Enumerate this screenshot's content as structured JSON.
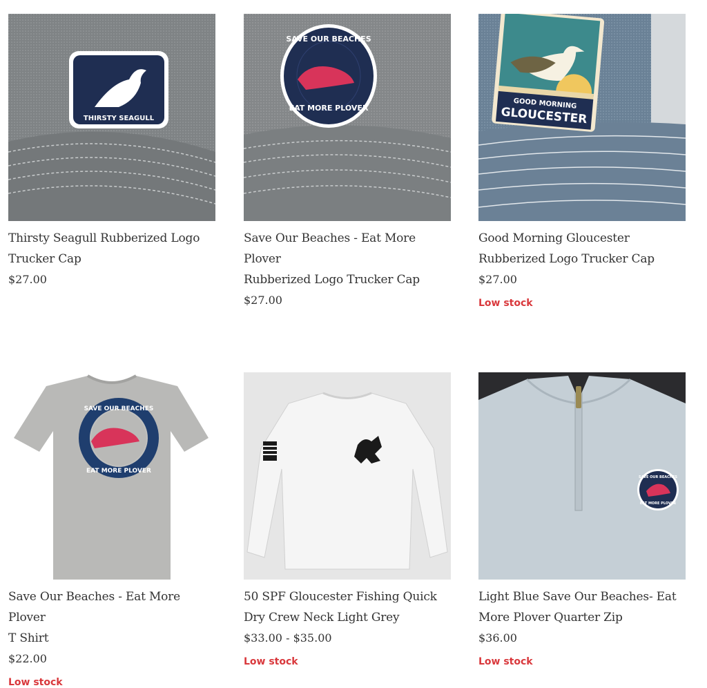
{
  "products": [
    {
      "title_line1": "Thirsty Seagull Rubberized Logo",
      "title_line2": "Trucker Cap",
      "price": "$27.00",
      "stock": "",
      "patch_text": "THIRSTY SEAGULL"
    },
    {
      "title_line1": "Save Our Beaches - Eat More Plover",
      "title_line2": "Rubberized Logo Trucker Cap",
      "price": "$27.00",
      "stock": "",
      "patch_text_top": "SAVE OUR BEACHES",
      "patch_text_bottom": "EAT MORE PLOVER"
    },
    {
      "title_line1": "Good Morning Gloucester",
      "title_line2": "Rubberized Logo Trucker Cap",
      "price": "$27.00",
      "stock": "Low stock",
      "patch_text_top": "GOOD MORNING",
      "patch_text_bottom": "GLOUCESTER"
    },
    {
      "title_line1": "Save Our Beaches - Eat More Plover",
      "title_line2": "T Shirt",
      "price": "$22.00",
      "stock": "Low stock",
      "patch_text_top": "SAVE OUR BEACHES",
      "patch_text_bottom": "EAT MORE PLOVER"
    },
    {
      "title_line1": "50 SPF Gloucester Fishing Quick",
      "title_line2": "Dry Crew Neck Light Grey",
      "price": "$33.00 - $35.00",
      "stock": "Low stock"
    },
    {
      "title_line1": "Light Blue Save Our Beaches- Eat",
      "title_line2": "More Plover Quarter Zip",
      "price": "$36.00",
      "stock": "Low stock",
      "patch_text_top": "SAVE OUR BEACHES",
      "patch_text_bottom": "EAT MORE PLOVER"
    }
  ],
  "colors": {
    "stock": "#d9383c",
    "navy": "#1c2b4a",
    "plover": "#d8345a"
  }
}
